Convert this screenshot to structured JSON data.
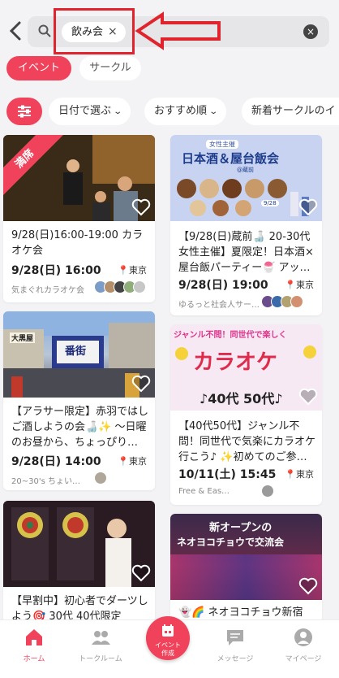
{
  "search": {
    "chip_label": "飲み会",
    "chip_close": "×",
    "clear": "×"
  },
  "tabs": [
    {
      "label": "イベント"
    },
    {
      "label": "サークル"
    }
  ],
  "filters": [
    {
      "label": "日付で選ぶ"
    },
    {
      "label": "おすすめ順"
    },
    {
      "label": "新着サークルのイ"
    }
  ],
  "cards": [
    {
      "badge": "満席",
      "title": "9/28(日)16:00-19:00 カラオケ会",
      "date": "9/28(日) 16:00",
      "location": "東京",
      "organizer": "気まぐれカラオケ会"
    },
    {
      "banner_title": "日本酒＆屋台飯会",
      "banner_sub": "女性主催",
      "banner_place": "@蔵前",
      "banner_date": "9/28",
      "title": "【9/28(日)蔵前🍶 20-30代女性主催】夏限定！日本酒×屋台飯パーティー🍧 アッ…",
      "date": "9/28(日) 19:00",
      "location": "東京",
      "organizer": "ゆるっと社会人サー…"
    },
    {
      "banner_sign": "番街",
      "banner_sign2": "大黒屋",
      "title": "【アラサー限定】赤羽ではしご酒しようの会🍶✨ 〜日曜のお昼から、ちょっぴり…",
      "date": "9/28(日) 14:00",
      "location": "東京",
      "organizer": "20~30's ちょい…"
    },
    {
      "banner_top": "ジャンル不問！同世代で楽しく",
      "banner_main": "カラオケ",
      "banner_bottom": "♪40代 50代♪",
      "title": "【40代50代】ジャンル不問！同世代で気楽にカラオケ行こう♪ ✨初めてのご参…",
      "date": "10/11(土) 15:45",
      "location": "東京",
      "organizer": "Free & Eas…"
    },
    {
      "title": "【早割中】初心者でダーツしよう🎯 30代 40代限定",
      "date": "",
      "location": "",
      "organizer": ""
    },
    {
      "banner_line1": "新オープンの",
      "banner_line2": "ネオヨコチョウで交流会",
      "title": "👻🌈 ネオヨコチョウ新宿",
      "date": "",
      "location": "",
      "organizer": ""
    }
  ],
  "nav": [
    {
      "label": "ホーム"
    },
    {
      "label": "トークルーム"
    },
    {
      "label_line1": "イベント",
      "label_line2": "作成"
    },
    {
      "label": "メッセージ"
    },
    {
      "label": "マイページ"
    }
  ],
  "colors": {
    "accent": "#f0425a",
    "annotation": "#e0242e"
  }
}
